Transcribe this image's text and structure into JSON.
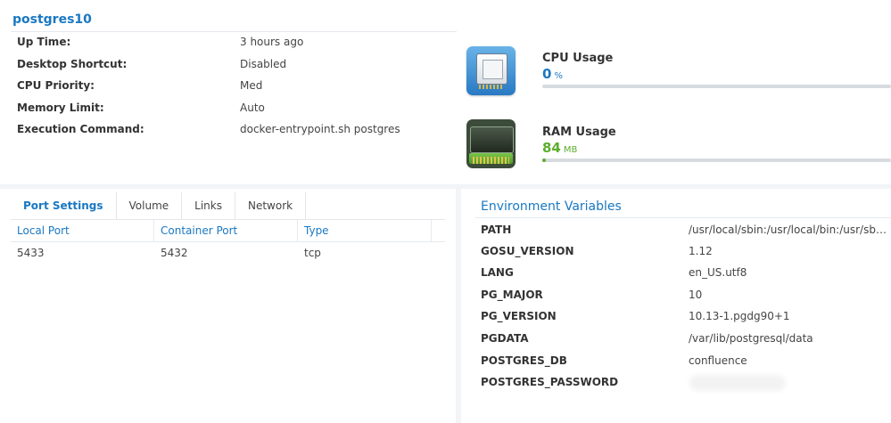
{
  "container": {
    "name": "postgres10"
  },
  "info": [
    {
      "label": "Up Time:",
      "value": "3 hours ago"
    },
    {
      "label": "Desktop Shortcut:",
      "value": "Disabled"
    },
    {
      "label": "CPU Priority:",
      "value": "Med"
    },
    {
      "label": "Memory Limit:",
      "value": "Auto"
    },
    {
      "label": "Execution Command:",
      "value": "docker-entrypoint.sh postgres"
    }
  ],
  "usage": {
    "cpu": {
      "label": "CPU Usage",
      "value": "0",
      "unit": "%",
      "icon": "cpu-chip-icon",
      "color": "#1a78c2",
      "fill_fraction": 0.0
    },
    "ram": {
      "label": "RAM Usage",
      "value": "84",
      "unit": "MB",
      "icon": "ram-module-icon",
      "color": "#5cae2e",
      "fill_fraction": 0.01
    }
  },
  "port_tabs": [
    {
      "label": "Port Settings",
      "active": true
    },
    {
      "label": "Volume",
      "active": false
    },
    {
      "label": "Links",
      "active": false
    },
    {
      "label": "Network",
      "active": false
    }
  ],
  "port_table": {
    "headers": [
      "Local Port",
      "Container Port",
      "Type"
    ],
    "rows": [
      [
        "5433",
        "5432",
        "tcp"
      ]
    ]
  },
  "env": {
    "title": "Environment Variables",
    "vars": [
      {
        "key": "PATH",
        "value": "/usr/local/sbin:/usr/local/bin:/usr/sbin:/usr/bin:/sbin:/bin"
      },
      {
        "key": "GOSU_VERSION",
        "value": "1.12"
      },
      {
        "key": "LANG",
        "value": "en_US.utf8"
      },
      {
        "key": "PG_MAJOR",
        "value": "10"
      },
      {
        "key": "PG_VERSION",
        "value": "10.13-1.pgdg90+1"
      },
      {
        "key": "PGDATA",
        "value": "/var/lib/postgresql/data"
      },
      {
        "key": "POSTGRES_DB",
        "value": "confluence"
      },
      {
        "key": "POSTGRES_PASSWORD",
        "value": ""
      }
    ]
  },
  "colors": {
    "accent": "#1a78c2",
    "ram_green": "#5cae2e",
    "bar_track": "#d7dbe0"
  }
}
